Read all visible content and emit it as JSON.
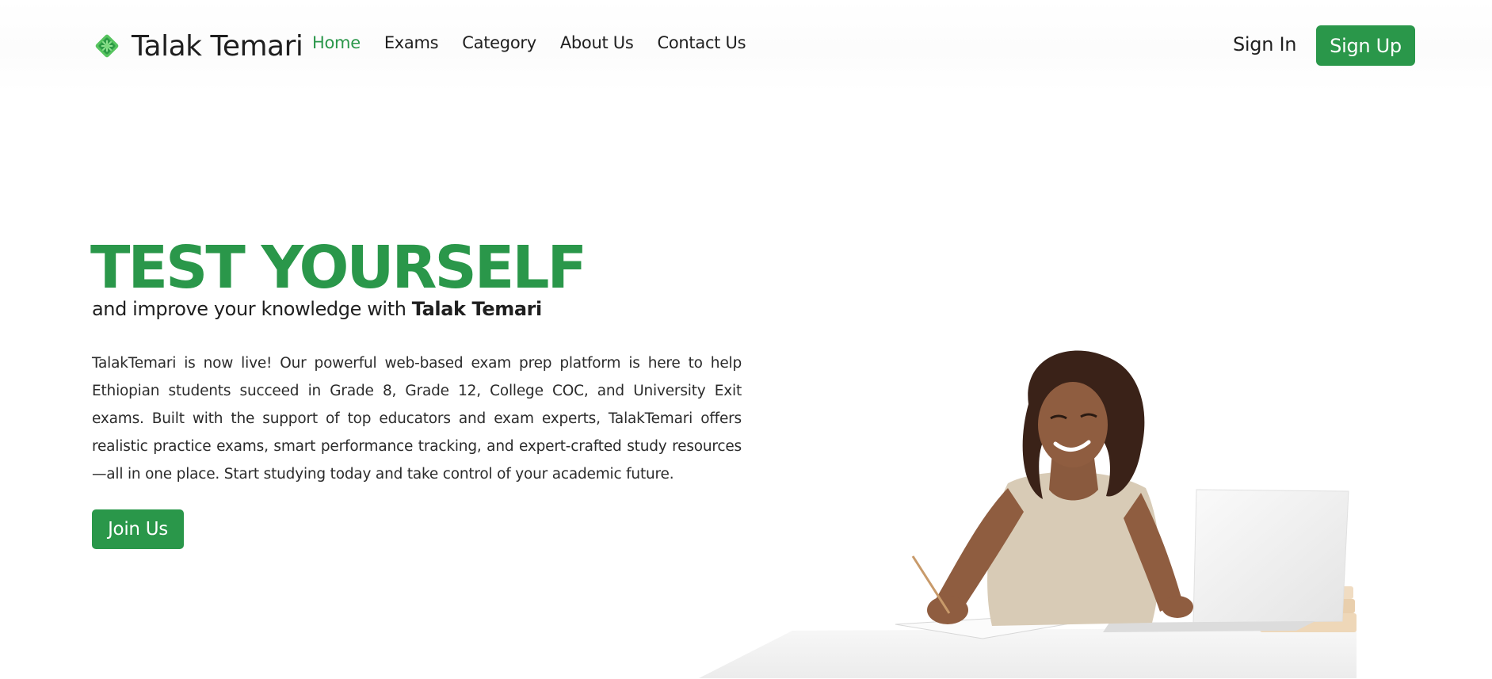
{
  "brand": {
    "name": "Talak Temari",
    "logo_icon": "green-lattice-logo-icon",
    "accent_color": "#2a974a"
  },
  "nav": {
    "items": [
      {
        "label": "Home",
        "active": true
      },
      {
        "label": "Exams",
        "active": false
      },
      {
        "label": "Category",
        "active": false
      },
      {
        "label": "About Us",
        "active": false
      },
      {
        "label": "Contact Us",
        "active": false
      }
    ]
  },
  "auth": {
    "signin_label": "Sign In",
    "signup_label": "Sign Up"
  },
  "hero": {
    "title": "TEST YOURSELF",
    "subtitle_prefix": "and improve your knowledge with ",
    "subtitle_brand": "Talak Temari",
    "description": "TalakTemari is now live! Our powerful web-based exam prep platform is here to help Ethiopian students succeed in Grade 8, Grade 12, College COC, and University Exit exams. Built with the support of top educators and exam experts, TalakTemari offers realistic practice exams, smart performance tracking, and expert-crafted study resources—all in one place. Start studying today and take control of your academic future.",
    "cta_label": "Join Us",
    "image": "student-studying-at-desk-illustration"
  }
}
